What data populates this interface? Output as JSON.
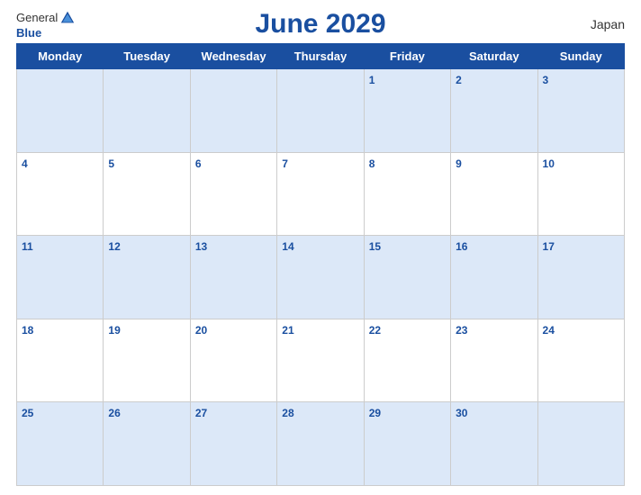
{
  "header": {
    "logo_general": "General",
    "logo_blue": "Blue",
    "title": "June 2029",
    "country": "Japan"
  },
  "days_of_week": [
    "Monday",
    "Tuesday",
    "Wednesday",
    "Thursday",
    "Friday",
    "Saturday",
    "Sunday"
  ],
  "weeks": [
    [
      {
        "day": "",
        "empty": true
      },
      {
        "day": "",
        "empty": true
      },
      {
        "day": "",
        "empty": true
      },
      {
        "day": "",
        "empty": true
      },
      {
        "day": "1",
        "empty": false
      },
      {
        "day": "2",
        "empty": false
      },
      {
        "day": "3",
        "empty": false
      }
    ],
    [
      {
        "day": "4",
        "empty": false
      },
      {
        "day": "5",
        "empty": false
      },
      {
        "day": "6",
        "empty": false
      },
      {
        "day": "7",
        "empty": false
      },
      {
        "day": "8",
        "empty": false
      },
      {
        "day": "9",
        "empty": false
      },
      {
        "day": "10",
        "empty": false
      }
    ],
    [
      {
        "day": "11",
        "empty": false
      },
      {
        "day": "12",
        "empty": false
      },
      {
        "day": "13",
        "empty": false
      },
      {
        "day": "14",
        "empty": false
      },
      {
        "day": "15",
        "empty": false
      },
      {
        "day": "16",
        "empty": false
      },
      {
        "day": "17",
        "empty": false
      }
    ],
    [
      {
        "day": "18",
        "empty": false
      },
      {
        "day": "19",
        "empty": false
      },
      {
        "day": "20",
        "empty": false
      },
      {
        "day": "21",
        "empty": false
      },
      {
        "day": "22",
        "empty": false
      },
      {
        "day": "23",
        "empty": false
      },
      {
        "day": "24",
        "empty": false
      }
    ],
    [
      {
        "day": "25",
        "empty": false
      },
      {
        "day": "26",
        "empty": false
      },
      {
        "day": "27",
        "empty": false
      },
      {
        "day": "28",
        "empty": false
      },
      {
        "day": "29",
        "empty": false
      },
      {
        "day": "30",
        "empty": false
      },
      {
        "day": "",
        "empty": true
      }
    ]
  ]
}
